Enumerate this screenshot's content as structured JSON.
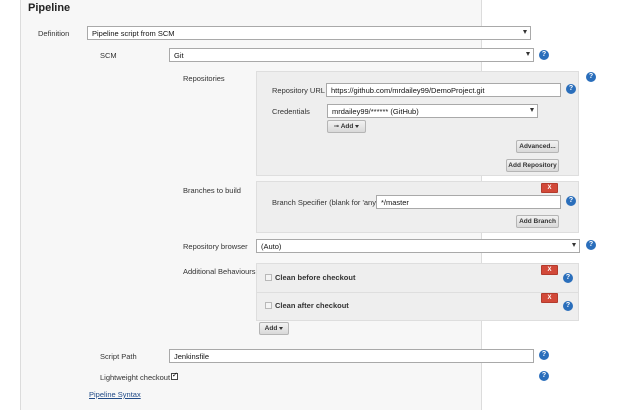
{
  "section_title": "Pipeline",
  "definition": {
    "label": "Definition",
    "value": "Pipeline script from SCM"
  },
  "scm": {
    "label": "SCM",
    "value": "Git"
  },
  "repositories": {
    "label": "Repositories",
    "url_label": "Repository URL",
    "url_value": "https://github.com/mrdailey99/DemoProject.git",
    "credentials_label": "Credentials",
    "credentials_value": "mrdailey99/****** (GitHub)",
    "add_label": "Add",
    "advanced_label": "Advanced...",
    "add_repository_label": "Add Repository"
  },
  "branches": {
    "label": "Branches to build",
    "specifier_label": "Branch Specifier (blank for 'any')",
    "specifier_value": "*/master",
    "add_branch_label": "Add Branch",
    "delete_label": "X"
  },
  "repository_browser": {
    "label": "Repository browser",
    "value": "(Auto)"
  },
  "additional_behaviours": {
    "label": "Additional Behaviours",
    "items": [
      {
        "label": "Clean before checkout",
        "delete_label": "X"
      },
      {
        "label": "Clean after checkout",
        "delete_label": "X"
      }
    ],
    "add_label": "Add"
  },
  "script_path": {
    "label": "Script Path",
    "value": "Jenkinsfile"
  },
  "lightweight_checkout": {
    "label": "Lightweight checkout",
    "checked": true
  },
  "pipeline_syntax_link": "Pipeline Syntax",
  "help_glyph": "?",
  "colors": {
    "help": "#2a6ebb",
    "delete": "#d24939",
    "link": "#204a87"
  },
  "icons": {
    "add_key": "key-icon",
    "help": "help-icon",
    "dropdown": "chevron-down-icon"
  }
}
